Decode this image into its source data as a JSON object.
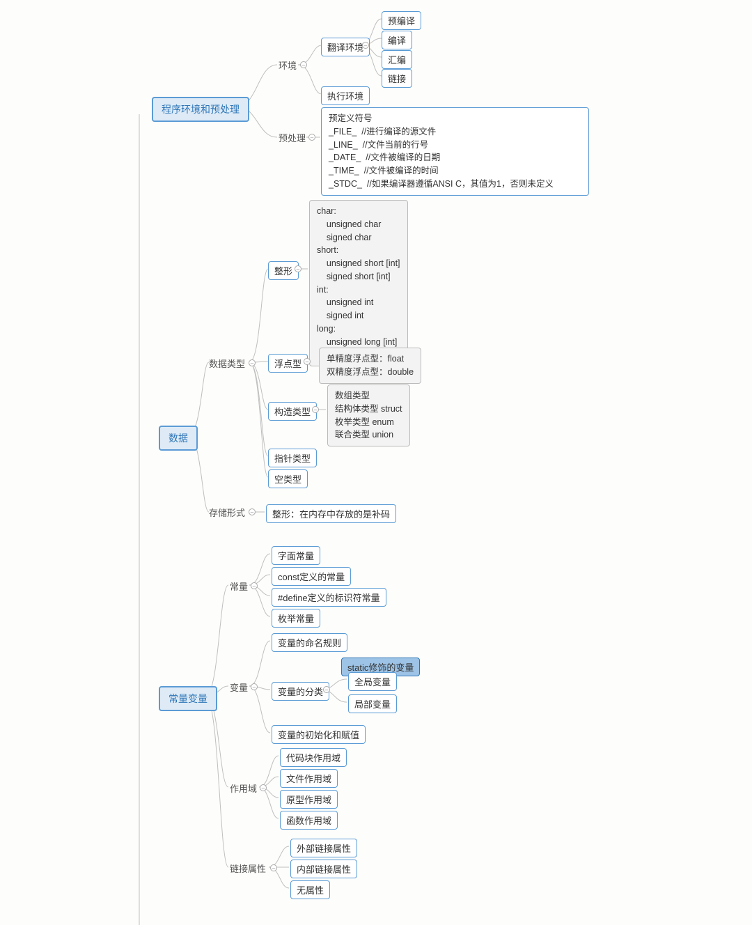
{
  "roots": {
    "env": "程序环境和预处理",
    "data": "数据",
    "constvar": "常量变量"
  },
  "labels": {
    "huanjing": "环境",
    "yuchuli": "预处理",
    "shujuleixing": "数据类型",
    "cunchuxingshi": "存储形式",
    "changliang": "常量",
    "bianliang": "变量",
    "zuoyongyu": "作用域",
    "lianjieshuxing": "链接属性"
  },
  "nodes": {
    "fanyihuanjing": "翻译环境",
    "yubianyi": "预编译",
    "bianyi": "编译",
    "huibian": "汇编",
    "lianjie": "链接",
    "zhixinghuanjing": "执行环境",
    "predef": "预定义符号\n_FILE_  //进行编译的源文件\n_LINE_  //文件当前的行号\n_DATE_  //文件被编译的日期\n_TIME_  //文件被编译的时间\n_STDC_  //如果编译器遵循ANSI C，其值为1，否则未定义",
    "zhengxing": "整形",
    "zhengxingblock": "char:\n    unsigned char\n    signed char\nshort:\n    unsigned short [int]\n    signed short [int]\nint:\n    unsigned int\n    signed int\nlong:\n    unsigned long [int]\n    signed long [int]",
    "fudianxing": "浮点型",
    "fudianblock": "单精度浮点型：float\n双精度浮点型：double",
    "gouzaoleixing": "构造类型",
    "gouzaoblock": "数组类型\n结构体类型 struct\n枚举类型 enum\n联合类型 union",
    "zhizhenleixing": "指针类型",
    "kongleixing": "空类型",
    "zhengxingbuma": "整形：在内存中存放的是补码",
    "zimianchangliang": "字面常量",
    "constdef": "const定义的常量",
    "definedef": "#define定义的标识符常量",
    "meijuchangliang": "枚举常量",
    "mingmingguize": "变量的命名规则",
    "fenleibianliang": "变量的分类",
    "staticvar": "static修饰的变量",
    "quanjubianliang": "全局变量",
    "jububianliang": "局部变量",
    "chushihua": "变量的初始化和赋值",
    "daimakuaizuoyongyu": "代码块作用域",
    "wenjianzuoyongyu": "文件作用域",
    "yuanxingzuoyongyu": "原型作用域",
    "hanshuzuoyongyu": "函数作用域",
    "waibulianjieshuxing": "外部链接属性",
    "neibulianjieshuxing": "内部链接属性",
    "wushuxing": "无属性"
  }
}
